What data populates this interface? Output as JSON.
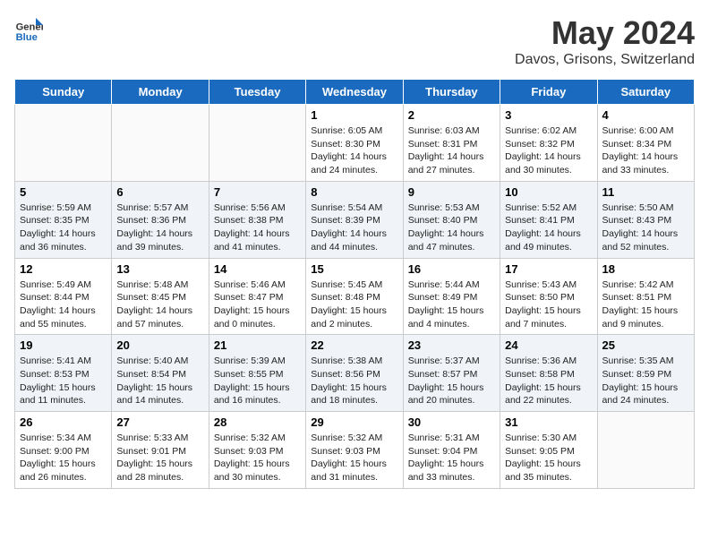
{
  "header": {
    "logo_general": "General",
    "logo_blue": "Blue",
    "title": "May 2024",
    "subtitle": "Davos, Grisons, Switzerland"
  },
  "days_of_week": [
    "Sunday",
    "Monday",
    "Tuesday",
    "Wednesday",
    "Thursday",
    "Friday",
    "Saturday"
  ],
  "weeks": [
    [
      {
        "day": "",
        "sunrise": "",
        "sunset": "",
        "daylight": "",
        "empty": true
      },
      {
        "day": "",
        "sunrise": "",
        "sunset": "",
        "daylight": "",
        "empty": true
      },
      {
        "day": "",
        "sunrise": "",
        "sunset": "",
        "daylight": "",
        "empty": true
      },
      {
        "day": "1",
        "sunrise": "Sunrise: 6:05 AM",
        "sunset": "Sunset: 8:30 PM",
        "daylight": "Daylight: 14 hours and 24 minutes.",
        "empty": false
      },
      {
        "day": "2",
        "sunrise": "Sunrise: 6:03 AM",
        "sunset": "Sunset: 8:31 PM",
        "daylight": "Daylight: 14 hours and 27 minutes.",
        "empty": false
      },
      {
        "day": "3",
        "sunrise": "Sunrise: 6:02 AM",
        "sunset": "Sunset: 8:32 PM",
        "daylight": "Daylight: 14 hours and 30 minutes.",
        "empty": false
      },
      {
        "day": "4",
        "sunrise": "Sunrise: 6:00 AM",
        "sunset": "Sunset: 8:34 PM",
        "daylight": "Daylight: 14 hours and 33 minutes.",
        "empty": false
      }
    ],
    [
      {
        "day": "5",
        "sunrise": "Sunrise: 5:59 AM",
        "sunset": "Sunset: 8:35 PM",
        "daylight": "Daylight: 14 hours and 36 minutes.",
        "empty": false
      },
      {
        "day": "6",
        "sunrise": "Sunrise: 5:57 AM",
        "sunset": "Sunset: 8:36 PM",
        "daylight": "Daylight: 14 hours and 39 minutes.",
        "empty": false
      },
      {
        "day": "7",
        "sunrise": "Sunrise: 5:56 AM",
        "sunset": "Sunset: 8:38 PM",
        "daylight": "Daylight: 14 hours and 41 minutes.",
        "empty": false
      },
      {
        "day": "8",
        "sunrise": "Sunrise: 5:54 AM",
        "sunset": "Sunset: 8:39 PM",
        "daylight": "Daylight: 14 hours and 44 minutes.",
        "empty": false
      },
      {
        "day": "9",
        "sunrise": "Sunrise: 5:53 AM",
        "sunset": "Sunset: 8:40 PM",
        "daylight": "Daylight: 14 hours and 47 minutes.",
        "empty": false
      },
      {
        "day": "10",
        "sunrise": "Sunrise: 5:52 AM",
        "sunset": "Sunset: 8:41 PM",
        "daylight": "Daylight: 14 hours and 49 minutes.",
        "empty": false
      },
      {
        "day": "11",
        "sunrise": "Sunrise: 5:50 AM",
        "sunset": "Sunset: 8:43 PM",
        "daylight": "Daylight: 14 hours and 52 minutes.",
        "empty": false
      }
    ],
    [
      {
        "day": "12",
        "sunrise": "Sunrise: 5:49 AM",
        "sunset": "Sunset: 8:44 PM",
        "daylight": "Daylight: 14 hours and 55 minutes.",
        "empty": false
      },
      {
        "day": "13",
        "sunrise": "Sunrise: 5:48 AM",
        "sunset": "Sunset: 8:45 PM",
        "daylight": "Daylight: 14 hours and 57 minutes.",
        "empty": false
      },
      {
        "day": "14",
        "sunrise": "Sunrise: 5:46 AM",
        "sunset": "Sunset: 8:47 PM",
        "daylight": "Daylight: 15 hours and 0 minutes.",
        "empty": false
      },
      {
        "day": "15",
        "sunrise": "Sunrise: 5:45 AM",
        "sunset": "Sunset: 8:48 PM",
        "daylight": "Daylight: 15 hours and 2 minutes.",
        "empty": false
      },
      {
        "day": "16",
        "sunrise": "Sunrise: 5:44 AM",
        "sunset": "Sunset: 8:49 PM",
        "daylight": "Daylight: 15 hours and 4 minutes.",
        "empty": false
      },
      {
        "day": "17",
        "sunrise": "Sunrise: 5:43 AM",
        "sunset": "Sunset: 8:50 PM",
        "daylight": "Daylight: 15 hours and 7 minutes.",
        "empty": false
      },
      {
        "day": "18",
        "sunrise": "Sunrise: 5:42 AM",
        "sunset": "Sunset: 8:51 PM",
        "daylight": "Daylight: 15 hours and 9 minutes.",
        "empty": false
      }
    ],
    [
      {
        "day": "19",
        "sunrise": "Sunrise: 5:41 AM",
        "sunset": "Sunset: 8:53 PM",
        "daylight": "Daylight: 15 hours and 11 minutes.",
        "empty": false
      },
      {
        "day": "20",
        "sunrise": "Sunrise: 5:40 AM",
        "sunset": "Sunset: 8:54 PM",
        "daylight": "Daylight: 15 hours and 14 minutes.",
        "empty": false
      },
      {
        "day": "21",
        "sunrise": "Sunrise: 5:39 AM",
        "sunset": "Sunset: 8:55 PM",
        "daylight": "Daylight: 15 hours and 16 minutes.",
        "empty": false
      },
      {
        "day": "22",
        "sunrise": "Sunrise: 5:38 AM",
        "sunset": "Sunset: 8:56 PM",
        "daylight": "Daylight: 15 hours and 18 minutes.",
        "empty": false
      },
      {
        "day": "23",
        "sunrise": "Sunrise: 5:37 AM",
        "sunset": "Sunset: 8:57 PM",
        "daylight": "Daylight: 15 hours and 20 minutes.",
        "empty": false
      },
      {
        "day": "24",
        "sunrise": "Sunrise: 5:36 AM",
        "sunset": "Sunset: 8:58 PM",
        "daylight": "Daylight: 15 hours and 22 minutes.",
        "empty": false
      },
      {
        "day": "25",
        "sunrise": "Sunrise: 5:35 AM",
        "sunset": "Sunset: 8:59 PM",
        "daylight": "Daylight: 15 hours and 24 minutes.",
        "empty": false
      }
    ],
    [
      {
        "day": "26",
        "sunrise": "Sunrise: 5:34 AM",
        "sunset": "Sunset: 9:00 PM",
        "daylight": "Daylight: 15 hours and 26 minutes.",
        "empty": false
      },
      {
        "day": "27",
        "sunrise": "Sunrise: 5:33 AM",
        "sunset": "Sunset: 9:01 PM",
        "daylight": "Daylight: 15 hours and 28 minutes.",
        "empty": false
      },
      {
        "day": "28",
        "sunrise": "Sunrise: 5:32 AM",
        "sunset": "Sunset: 9:03 PM",
        "daylight": "Daylight: 15 hours and 30 minutes.",
        "empty": false
      },
      {
        "day": "29",
        "sunrise": "Sunrise: 5:32 AM",
        "sunset": "Sunset: 9:03 PM",
        "daylight": "Daylight: 15 hours and 31 minutes.",
        "empty": false
      },
      {
        "day": "30",
        "sunrise": "Sunrise: 5:31 AM",
        "sunset": "Sunset: 9:04 PM",
        "daylight": "Daylight: 15 hours and 33 minutes.",
        "empty": false
      },
      {
        "day": "31",
        "sunrise": "Sunrise: 5:30 AM",
        "sunset": "Sunset: 9:05 PM",
        "daylight": "Daylight: 15 hours and 35 minutes.",
        "empty": false
      },
      {
        "day": "",
        "sunrise": "",
        "sunset": "",
        "daylight": "",
        "empty": true
      }
    ]
  ]
}
